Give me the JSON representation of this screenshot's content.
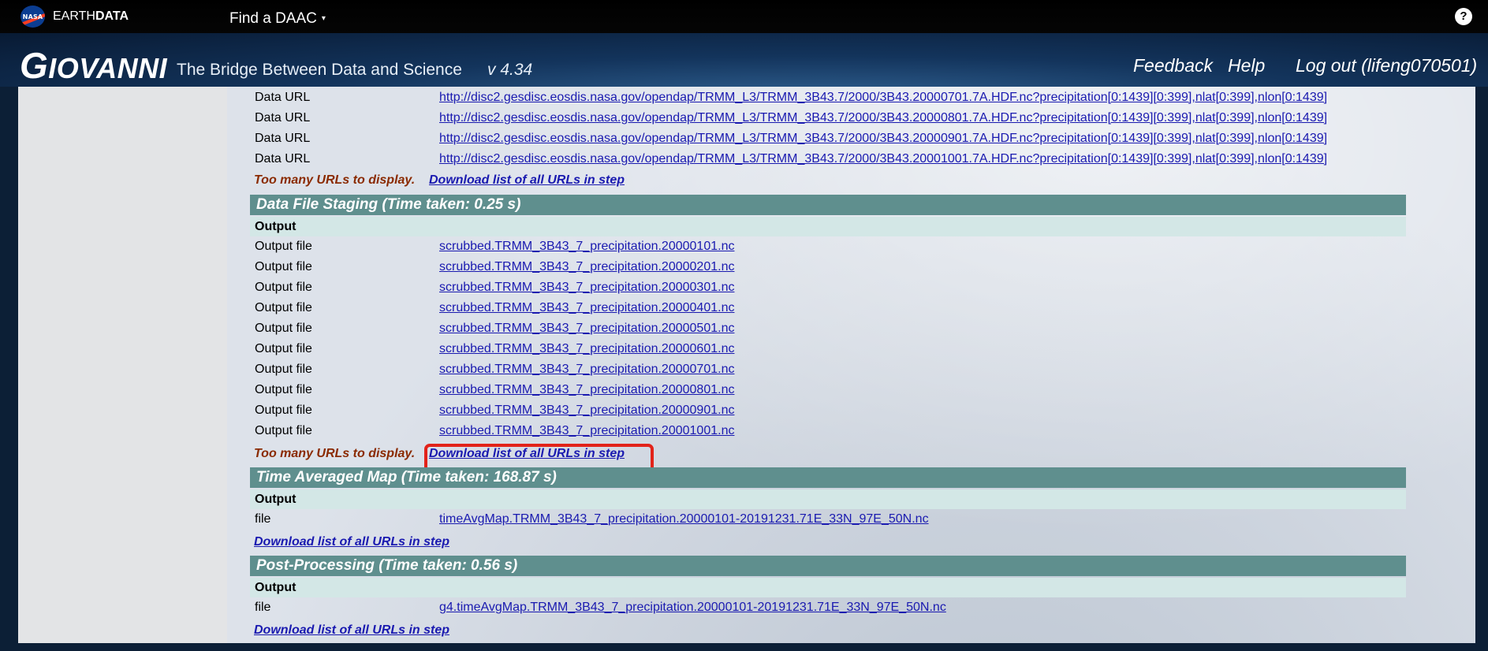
{
  "topbar": {
    "nasa_logo": "NASA",
    "earthdata_prefix": "EARTH",
    "earthdata_suffix": "DATA",
    "find_daac": "Find a DAAC",
    "caret": "▾",
    "help": "?"
  },
  "header": {
    "logo_first": "G",
    "logo_rest": "IOVANNI",
    "tagline": "The Bridge Between Data and Science",
    "version": "v 4.34",
    "feedback": "Feedback",
    "help": "Help",
    "logout": "Log out (lifeng070501)"
  },
  "data_urls": {
    "label": "Data URL",
    "items": [
      "http://disc2.gesdisc.eosdis.nasa.gov/opendap/TRMM_L3/TRMM_3B43.7/2000/3B43.20000701.7A.HDF.nc?precipitation[0:1439][0:399],nlat[0:399],nlon[0:1439]",
      "http://disc2.gesdisc.eosdis.nasa.gov/opendap/TRMM_L3/TRMM_3B43.7/2000/3B43.20000801.7A.HDF.nc?precipitation[0:1439][0:399],nlat[0:399],nlon[0:1439]",
      "http://disc2.gesdisc.eosdis.nasa.gov/opendap/TRMM_L3/TRMM_3B43.7/2000/3B43.20000901.7A.HDF.nc?precipitation[0:1439][0:399],nlat[0:399],nlon[0:1439]",
      "http://disc2.gesdisc.eosdis.nasa.gov/opendap/TRMM_L3/TRMM_3B43.7/2000/3B43.20001001.7A.HDF.nc?precipitation[0:1439][0:399],nlat[0:399],nlon[0:1439]"
    ],
    "too_many": "Too many URLs to display.",
    "download": "Download list of all URLs in step"
  },
  "staging": {
    "title": "Data File Staging (Time taken: 0.25 s)",
    "output_header": "Output",
    "label": "Output file",
    "files": [
      "scrubbed.TRMM_3B43_7_precipitation.20000101.nc",
      "scrubbed.TRMM_3B43_7_precipitation.20000201.nc",
      "scrubbed.TRMM_3B43_7_precipitation.20000301.nc",
      "scrubbed.TRMM_3B43_7_precipitation.20000401.nc",
      "scrubbed.TRMM_3B43_7_precipitation.20000501.nc",
      "scrubbed.TRMM_3B43_7_precipitation.20000601.nc",
      "scrubbed.TRMM_3B43_7_precipitation.20000701.nc",
      "scrubbed.TRMM_3B43_7_precipitation.20000801.nc",
      "scrubbed.TRMM_3B43_7_precipitation.20000901.nc",
      "scrubbed.TRMM_3B43_7_precipitation.20001001.nc"
    ],
    "too_many": "Too many URLs to display.",
    "download": "Download list of all URLs in step"
  },
  "time_avg": {
    "title": "Time Averaged Map (Time taken: 168.87 s)",
    "output_header": "Output",
    "label": "file",
    "file": "timeAvgMap.TRMM_3B43_7_precipitation.20000101-20191231.71E_33N_97E_50N.nc",
    "download": "Download list of all URLs in step"
  },
  "post": {
    "title": "Post-Processing (Time taken: 0.56 s)",
    "output_header": "Output",
    "label": "file",
    "file": "g4.timeAvgMap.TRMM_3B43_7_precipitation.20000101-20191231.71E_33N_97E_50N.nc",
    "download": "Download list of all URLs in step"
  },
  "colors": {
    "section_bar": "#5f8f8e",
    "output_bar": "#d3e7e6",
    "link": "#1a1ab0",
    "warning": "#8a2a00",
    "highlight": "#e2231a"
  }
}
